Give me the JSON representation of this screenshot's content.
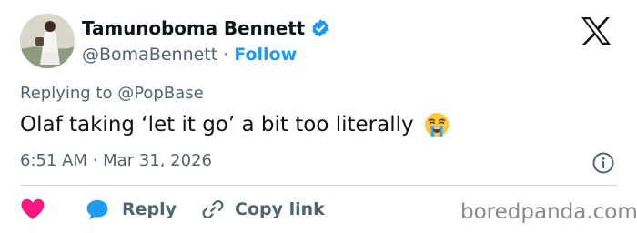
{
  "author": {
    "display_name": "Tamunoboma Bennett",
    "handle": "@BomaBennett",
    "separator": "·",
    "follow_label": "Follow",
    "verified": true
  },
  "platform_logo": "x-logo-icon",
  "reply_context": "Replying to @PopBase",
  "tweet": {
    "text": "Olaf taking ‘let it go’ a bit too literally",
    "emoji": "loudly-crying-face"
  },
  "meta": {
    "timestamp": "6:51 AM · Mar 31, 2026"
  },
  "actions": {
    "like_icon": "heart-icon",
    "reply_label": "Reply",
    "copy_label": "Copy link"
  },
  "watermark": "boredpanda.com",
  "colors": {
    "accent": "#1d9bf0",
    "like": "#f91880",
    "text": "#0f1419",
    "muted": "#536471",
    "divider": "#cfd9de"
  }
}
